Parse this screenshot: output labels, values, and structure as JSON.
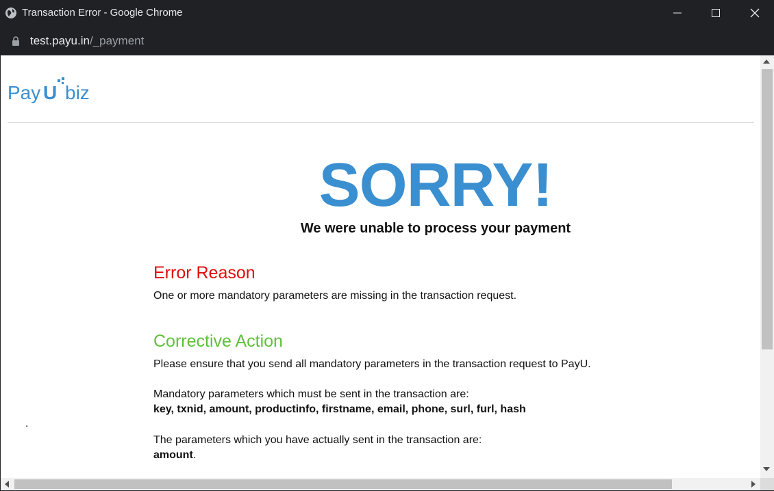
{
  "window": {
    "title": "Transaction Error - Google Chrome"
  },
  "address_bar": {
    "host": "test.payu.in",
    "path": "/_payment"
  },
  "logo": {
    "text_pay": "Pay",
    "text_u": "U",
    "text_biz": "biz",
    "color": "#3a8fd0"
  },
  "main": {
    "headline": "SORRY!",
    "subheadline": "We were unable to process your payment",
    "error_title": "Error Reason",
    "error_text": "One or more mandatory parameters are missing in the transaction request.",
    "action_title": "Corrective Action",
    "action_text": "Please ensure that you send all mandatory parameters in the transaction request to PayU.",
    "mandatory_intro": "Mandatory parameters which must be sent in the transaction are:",
    "mandatory_list": "key, txnid, amount, productinfo, firstname, email, phone, surl, furl, hash",
    "sent_intro": "The parameters which you have actually sent in the transaction are:",
    "sent_list": "amount",
    "sent_list_suffix": ".",
    "stray_dot": "."
  },
  "colors": {
    "headline": "#3a8fd0",
    "error_title": "#e00d0d",
    "action_title": "#5ec13a"
  }
}
